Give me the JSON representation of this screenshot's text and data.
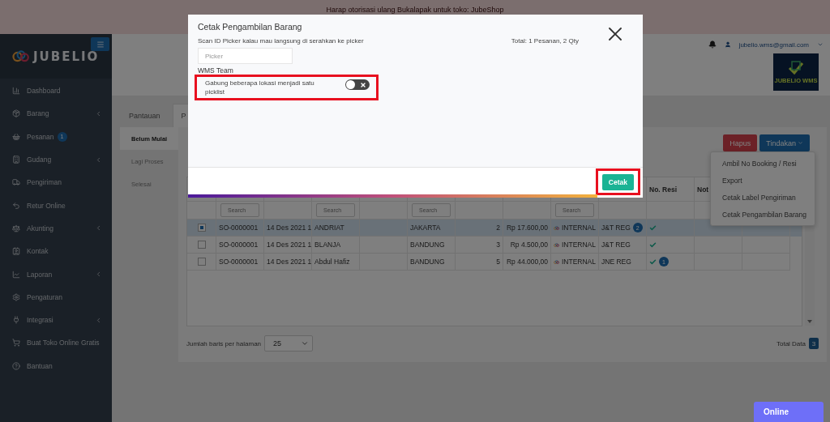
{
  "banner": {
    "text": "Harap otorisasi ulang Bukalapak untuk toko: JubeShop"
  },
  "sidebar": {
    "logo": "JUBELIO",
    "items": [
      {
        "label": "Dashboard",
        "submenu": false
      },
      {
        "label": "Barang",
        "submenu": true
      },
      {
        "label": "Pesanan",
        "submenu": false,
        "badge": "1"
      },
      {
        "label": "Gudang",
        "submenu": true
      },
      {
        "label": "Pengiriman",
        "submenu": false
      },
      {
        "label": "Retur Online",
        "submenu": false
      },
      {
        "label": "Akunting",
        "submenu": true
      },
      {
        "label": "Kontak",
        "submenu": false
      },
      {
        "label": "Laporan",
        "submenu": true
      },
      {
        "label": "Pengaturan",
        "submenu": false
      },
      {
        "label": "Integrasi",
        "submenu": true
      },
      {
        "label": "Buat Toko Online Gratis",
        "submenu": false
      },
      {
        "label": "Bantuan",
        "submenu": false
      }
    ]
  },
  "header": {
    "user_email": "jubelio.wms@gmail.com",
    "brand_logo": "JUBELIO WMS"
  },
  "tabs": [
    {
      "label": "Pantauan",
      "selected": false
    },
    {
      "label": "P",
      "selected": true
    }
  ],
  "status_tabs": [
    {
      "label": "Belum Mulai",
      "selected": true
    },
    {
      "label": "Lagi Proses",
      "selected": false
    },
    {
      "label": "Selesai",
      "selected": false
    }
  ],
  "actions": {
    "delete": "Hapus",
    "menu": "Tindakan",
    "menu_expanded": true,
    "menu_items": [
      "Ambil No Booking / Resi",
      "Export",
      "Cetak Label Pengiriman",
      "Cetak Pengambilan Barang"
    ]
  },
  "table": {
    "headings": [
      "No. Resi",
      "Not"
    ],
    "filters": [
      {
        "kind": "search",
        "placeholder": "Search"
      },
      {
        "kind": "blank"
      },
      {
        "kind": "search",
        "placeholder": "Search"
      },
      {
        "kind": "blank"
      },
      {
        "kind": "search",
        "placeholder": "Search"
      },
      {
        "kind": "blank"
      },
      {
        "kind": "blank"
      },
      {
        "kind": "search",
        "placeholder": "Search"
      },
      {
        "kind": "blank"
      },
      {
        "kind": "blank"
      },
      {
        "kind": "blank"
      },
      {
        "kind": "blank"
      }
    ],
    "rows": [
      {
        "selected": true,
        "cells": [
          {
            "kind": "text",
            "text": "SO-0000001"
          },
          {
            "kind": "text",
            "text": "14 Des 2021 1"
          },
          {
            "kind": "text",
            "text": "ANDRIAT"
          },
          {
            "kind": "blank"
          },
          {
            "kind": "text",
            "text": "JAKARTA"
          },
          {
            "kind": "number",
            "text": "2"
          },
          {
            "kind": "number",
            "text": "Rp 17.600,00"
          },
          {
            "kind": "channel",
            "text": "INTERNAL"
          },
          {
            "kind": "text",
            "text": "J&T REG",
            "badge": "2"
          },
          {
            "kind": "status"
          },
          {
            "kind": "blank"
          },
          {
            "kind": "blank"
          }
        ]
      },
      {
        "selected": false,
        "cells": [
          {
            "kind": "text",
            "text": "SO-0000001"
          },
          {
            "kind": "text",
            "text": "14 Des 2021 1"
          },
          {
            "kind": "text",
            "text": "BLANJA"
          },
          {
            "kind": "blank"
          },
          {
            "kind": "text",
            "text": "BANDUNG"
          },
          {
            "kind": "number",
            "text": "3"
          },
          {
            "kind": "number",
            "text": "Rp 4.500,00"
          },
          {
            "kind": "channel",
            "text": "INTERNAL"
          },
          {
            "kind": "text",
            "text": "J&T REG"
          },
          {
            "kind": "status"
          },
          {
            "kind": "blank"
          },
          {
            "kind": "blank"
          }
        ]
      },
      {
        "selected": false,
        "cells": [
          {
            "kind": "text",
            "text": "SO-0000001"
          },
          {
            "kind": "text",
            "text": "14 Des 2021 1"
          },
          {
            "kind": "text",
            "text": "Abdul Hafiz"
          },
          {
            "kind": "blank"
          },
          {
            "kind": "text",
            "text": "BANDUNG"
          },
          {
            "kind": "number",
            "text": "5"
          },
          {
            "kind": "number",
            "text": "Rp 44.000,00"
          },
          {
            "kind": "channel",
            "text": "INTERNAL"
          },
          {
            "kind": "text",
            "text": "JNE REG"
          },
          {
            "kind": "status",
            "badge": "1"
          },
          {
            "kind": "blank"
          },
          {
            "kind": "blank"
          }
        ]
      }
    ]
  },
  "pagination": {
    "label": "Jumlah baris per halaman",
    "page_size": "25",
    "total_label": "Total Data",
    "total": "3"
  },
  "modal": {
    "title": "Cetak Pengambilan Barang",
    "hint": "Scan ID Picker kalau mau langsung di serahkan ke picker",
    "total": "Total: 1 Pesanan, 2 Qty",
    "picker_placeholder": "Picker",
    "team": "WMS Team",
    "merge_toggle": {
      "label": "Gabung beberapa lokasi menjadi satu picklist",
      "on": false,
      "highlighted": true
    },
    "print_button": {
      "label": "Cetak",
      "highlighted": true
    }
  },
  "online_button": "Online"
}
